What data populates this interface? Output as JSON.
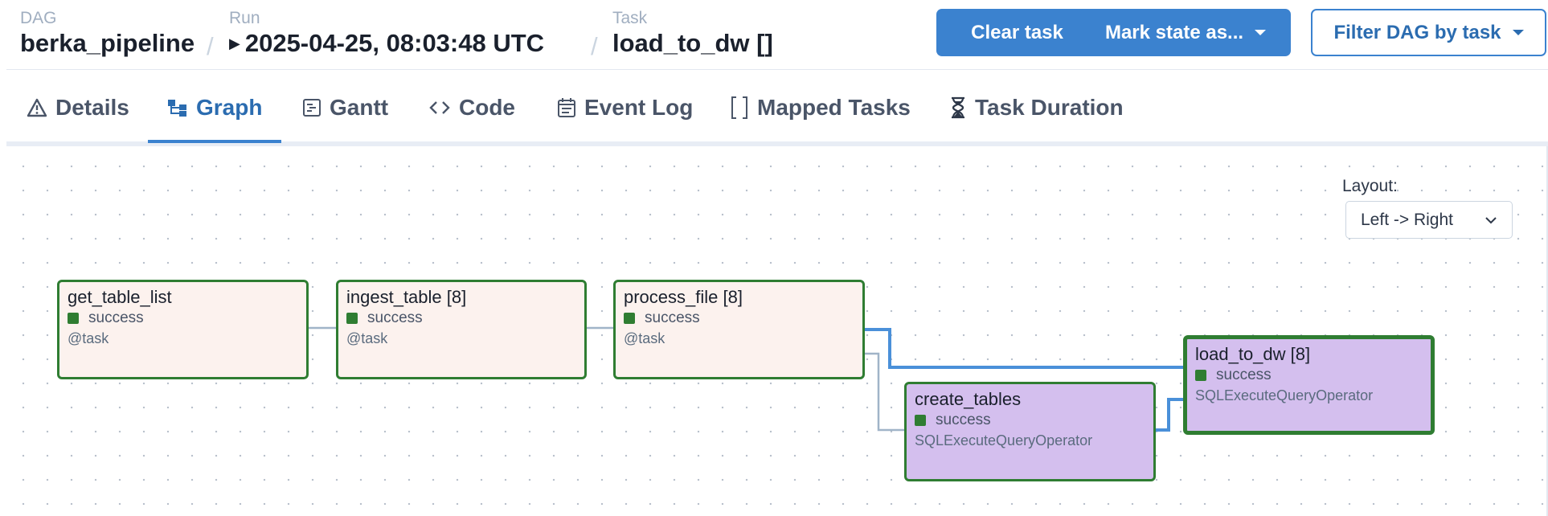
{
  "header": {
    "dag_label": "DAG",
    "dag_value": "berka_pipeline",
    "run_label": "Run",
    "run_value": "2025-04-25, 08:03:48 UTC",
    "task_label": "Task",
    "task_value": "load_to_dw []",
    "separator": "/"
  },
  "actions": {
    "clear_task": "Clear task",
    "mark_state": "Mark state as...",
    "filter_dag": "Filter DAG by task"
  },
  "tabs": [
    {
      "label": "Details",
      "icon": "warning-triangle-icon"
    },
    {
      "label": "Graph",
      "icon": "graph-icon"
    },
    {
      "label": "Gantt",
      "icon": "gantt-icon"
    },
    {
      "label": "Code",
      "icon": "code-icon"
    },
    {
      "label": "Event Log",
      "icon": "calendar-icon"
    },
    {
      "label": "Mapped Tasks",
      "icon": "brackets-icon"
    },
    {
      "label": "Task Duration",
      "icon": "hourglass-icon"
    }
  ],
  "active_tab": "Graph",
  "layout": {
    "label": "Layout:",
    "value": "Left -> Right"
  },
  "nodes": [
    {
      "name": "get_table_list",
      "state": "success",
      "operator": "@task"
    },
    {
      "name": "ingest_table [8]",
      "state": "success",
      "operator": "@task"
    },
    {
      "name": "process_file [8]",
      "state": "success",
      "operator": "@task"
    },
    {
      "name": "create_tables",
      "state": "success",
      "operator": "SQLExecuteQueryOperator"
    },
    {
      "name": "load_to_dw [8]",
      "state": "success",
      "operator": "SQLExecuteQueryOperator"
    }
  ],
  "colors": {
    "accent": "#3b82cf",
    "success": "#2f7d32",
    "task_bg": "#fcf2ee",
    "sql_bg": "#d4bfee",
    "edge": "#a0b4c8",
    "edge_highlight": "#4a90d9"
  }
}
